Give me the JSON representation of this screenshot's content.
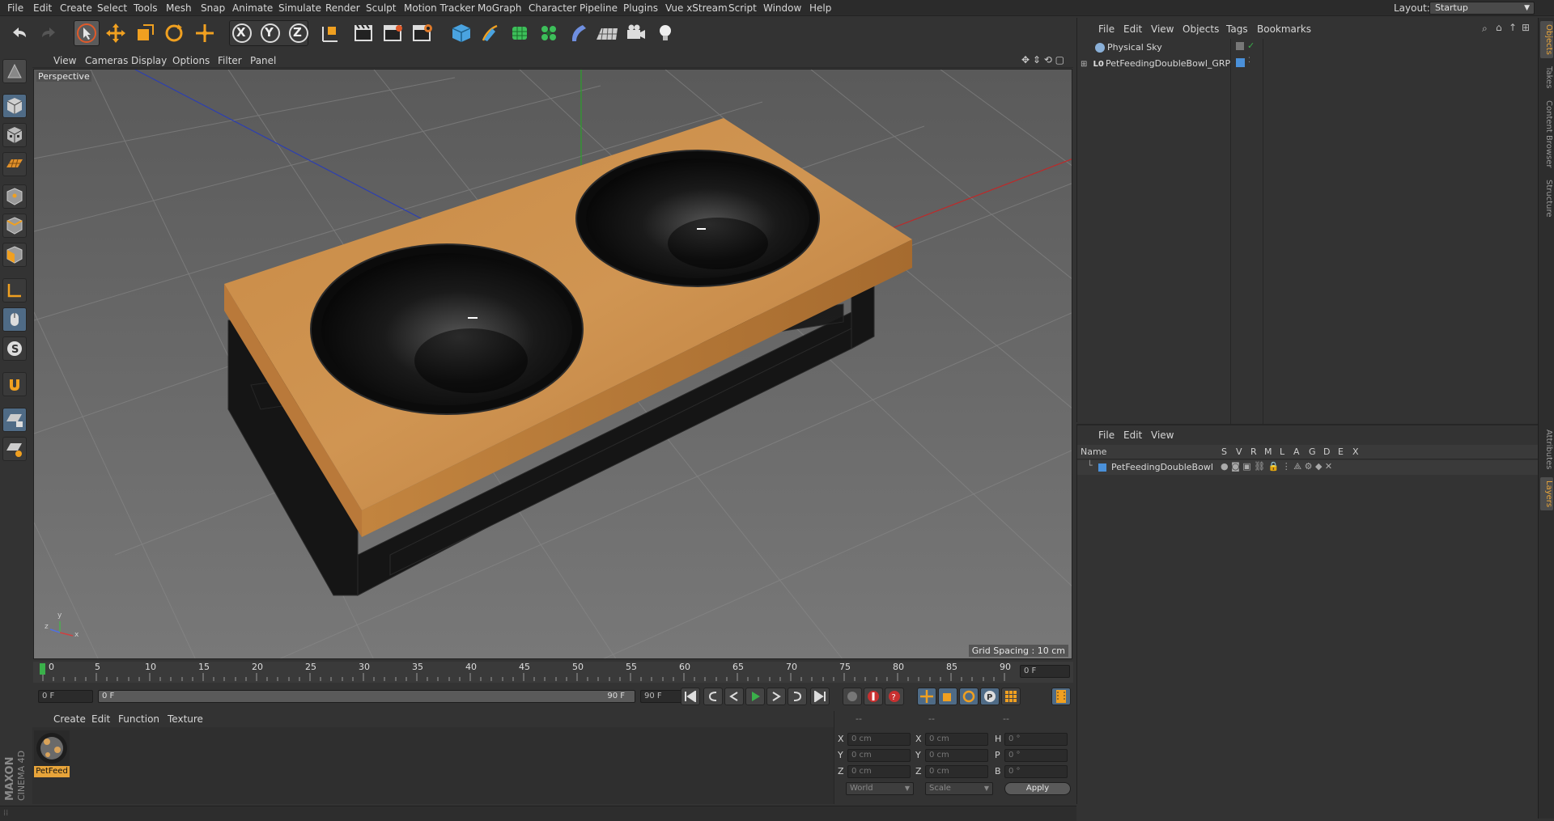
{
  "menu": [
    "File",
    "Edit",
    "Create",
    "Select",
    "Tools",
    "Mesh",
    "Snap",
    "Animate",
    "Simulate",
    "Render",
    "Sculpt",
    "Motion Tracker",
    "MoGraph",
    "Character",
    "Pipeline",
    "Plugins",
    "Vue xStream",
    "Script",
    "Window",
    "Help"
  ],
  "layout": {
    "label": "Layout:",
    "value": "Startup"
  },
  "toolbar": {
    "x_label": "X",
    "y_label": "Y",
    "z_label": "Z"
  },
  "viewport": {
    "menu": [
      "View",
      "Cameras",
      "Display",
      "Options",
      "Filter",
      "Panel"
    ],
    "camera_label": "Perspective",
    "grid_spacing": "Grid Spacing : 10 cm",
    "axis_labels": {
      "x": "x",
      "y": "y",
      "z": "z"
    }
  },
  "timeline": {
    "ticks": [
      "0",
      "5",
      "10",
      "15",
      "20",
      "25",
      "30",
      "35",
      "40",
      "45",
      "50",
      "55",
      "60",
      "65",
      "70",
      "75",
      "80",
      "85",
      "90"
    ],
    "current_frame_right": "0 F",
    "start_field": "0 F",
    "range_start": "0 F",
    "range_end": "90 F",
    "end_field": "90 F"
  },
  "material_manager": {
    "menu": [
      "Create",
      "Edit",
      "Function",
      "Texture"
    ],
    "materials": [
      {
        "name": "PetFeed"
      }
    ]
  },
  "coordinates": {
    "headers": [
      "--",
      "--",
      "--"
    ],
    "rows": [
      {
        "l1": "X",
        "v1": "0 cm",
        "l2": "X",
        "v2": "0 cm",
        "l3": "H",
        "v3": "0 °"
      },
      {
        "l1": "Y",
        "v1": "0 cm",
        "l2": "Y",
        "v2": "0 cm",
        "l3": "P",
        "v3": "0 °"
      },
      {
        "l1": "Z",
        "v1": "0 cm",
        "l2": "Z",
        "v2": "0 cm",
        "l3": "B",
        "v3": "0 °"
      }
    ],
    "space": "World",
    "mode": "Scale",
    "apply": "Apply"
  },
  "object_manager": {
    "menu": [
      "File",
      "Edit",
      "View",
      "Objects",
      "Tags",
      "Bookmarks"
    ],
    "objects": [
      {
        "name": "Physical Sky"
      },
      {
        "name": "PetFeedingDoubleBowl_GRP"
      }
    ]
  },
  "layer_manager": {
    "menu": [
      "File",
      "Edit",
      "View"
    ],
    "columns": [
      "Name",
      "S",
      "V",
      "R",
      "M",
      "L",
      "A",
      "G",
      "D",
      "E",
      "X"
    ],
    "layers": [
      {
        "name": "PetFeedingDoubleBowl"
      }
    ]
  },
  "side_tabs": [
    "Objects",
    "Takes",
    "Content Browser",
    "Structure",
    "Attributes",
    "Layers"
  ],
  "branding": {
    "brand": "MAXON",
    "product": "CINEMA 4D"
  },
  "colors": {
    "accent": "#e7a43a",
    "wood": "#c8883f",
    "bowl": "#0a0a0a",
    "layer_blue": "#4a90d9"
  }
}
